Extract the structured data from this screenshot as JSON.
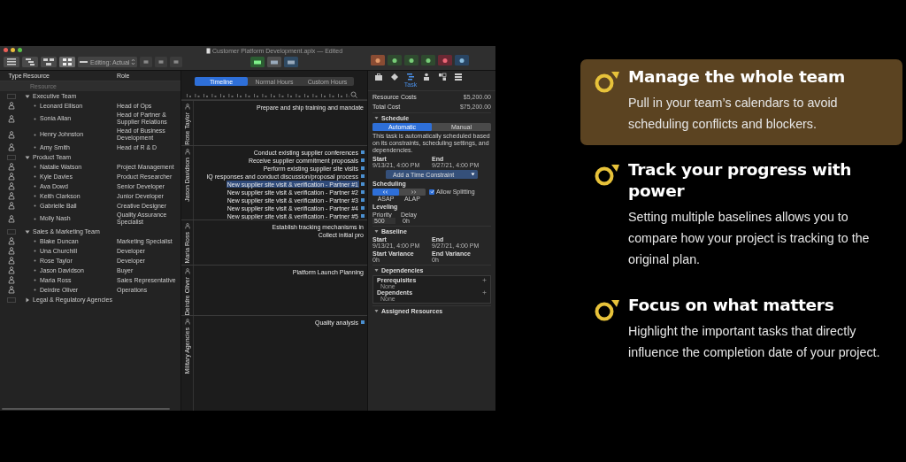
{
  "window": {
    "title": "Customer Platform Development.aplx — Edited",
    "mode_dropdown": "Editing: Actual"
  },
  "resource_table": {
    "columns": [
      "Type",
      "Resource",
      "Role"
    ],
    "placeholder": "Resource",
    "rows": [
      {
        "kind": "group",
        "name": "Executive Team",
        "expanded": true,
        "children": [
          {
            "kind": "person",
            "name": "Leonard Ellison",
            "role": "Head of Ops"
          },
          {
            "kind": "person",
            "name": "Sonia Allan",
            "role": "Head of Partner & Supplier Relations"
          },
          {
            "kind": "person",
            "name": "Henry Johnston",
            "role": "Head of Business Development"
          },
          {
            "kind": "person",
            "name": "Amy Smith",
            "role": "Head of R & D"
          }
        ]
      },
      {
        "kind": "group",
        "name": "Product Team",
        "expanded": true,
        "children": [
          {
            "kind": "person",
            "name": "Natalie Watson",
            "role": "Project Management"
          },
          {
            "kind": "person",
            "name": "Kyle Davies",
            "role": "Product Researcher"
          },
          {
            "kind": "person",
            "name": "Ava Dowd",
            "role": "Senior Developer"
          },
          {
            "kind": "person",
            "name": "Keith Clarkson",
            "role": "Junior Developer"
          },
          {
            "kind": "person",
            "name": "Gabrielle Ball",
            "role": "Creative Designer"
          },
          {
            "kind": "person",
            "name": "Molly Nash",
            "role": "Quality Assurance Specialist"
          }
        ]
      },
      {
        "kind": "group",
        "name": "Sales & Marketing Team",
        "expanded": true,
        "children": [
          {
            "kind": "person",
            "name": "Blake Duncan",
            "role": "Marketing Specialist"
          },
          {
            "kind": "person",
            "name": "Una Churchill",
            "role": "Developer"
          },
          {
            "kind": "person",
            "name": "Rose Taylor",
            "role": "Developer"
          },
          {
            "kind": "person",
            "name": "Jason Davidson",
            "role": "Buyer"
          },
          {
            "kind": "person",
            "name": "Maria Ross",
            "role": "Sales Representative"
          },
          {
            "kind": "person",
            "name": "Deirdre Oliver",
            "role": "Operations"
          }
        ]
      },
      {
        "kind": "group",
        "name": "Legal & Regulatory Agencies",
        "expanded": false,
        "children": []
      }
    ]
  },
  "timeline": {
    "tabs": [
      {
        "label": "Timeline",
        "selected": true
      },
      {
        "label": "Normal Hours",
        "selected": false
      },
      {
        "label": "Custom Hours",
        "selected": false
      }
    ],
    "lanes": [
      {
        "name": "Rose Taylor",
        "tasks": [
          {
            "label": "Prepare and ship training and mandate",
            "marker": false,
            "selected": false
          }
        ]
      },
      {
        "name": "Jason Davidson",
        "tasks": [
          {
            "label": "Conduct existing supplier conferences",
            "marker": true,
            "selected": false
          },
          {
            "label": "Receive supplier commitment proposals",
            "marker": true,
            "selected": false
          },
          {
            "label": "Perform existing supplier site visits",
            "marker": true,
            "selected": false
          },
          {
            "label": "IQ responses and conduct discussion/proposal process",
            "marker": true,
            "selected": false
          },
          {
            "label": "New supplier site visit & verification - Partner #1",
            "marker": true,
            "selected": true
          },
          {
            "label": "New supplier site visit & verification - Partner #2",
            "marker": true,
            "selected": false
          },
          {
            "label": "New supplier site visit & verification - Partner #3",
            "marker": true,
            "selected": false
          },
          {
            "label": "New supplier site visit & verification - Partner #4",
            "marker": true,
            "selected": false
          },
          {
            "label": "New supplier site visit & verification - Partner #5",
            "marker": true,
            "selected": false
          }
        ]
      },
      {
        "name": "Maria Ross",
        "tasks": [
          {
            "label": "Establish tracking mechanisms in",
            "marker": false,
            "selected": false
          },
          {
            "label": "Collect initial pro",
            "marker": false,
            "selected": false
          }
        ]
      },
      {
        "name": "Deirdre Oliver",
        "tasks": [
          {
            "label": "Platform Launch Planning",
            "marker": false,
            "selected": false
          }
        ]
      },
      {
        "name": "Military Agencies",
        "tasks": [
          {
            "label": "Quality analysis",
            "marker": true,
            "selected": false
          }
        ]
      }
    ]
  },
  "inspector": {
    "tabs": [
      {
        "selected": false
      },
      {
        "selected": false
      },
      {
        "label": "Task",
        "selected": true
      },
      {
        "selected": false
      },
      {
        "selected": false
      },
      {
        "selected": false
      }
    ],
    "costs": [
      {
        "label": "Resource Costs",
        "value": "$5,200.00"
      },
      {
        "label": "Total Cost",
        "value": "$75,200.00"
      }
    ],
    "schedule": {
      "title": "Schedule",
      "modes": [
        {
          "label": "Automatic",
          "selected": true
        },
        {
          "label": "Manual",
          "selected": false
        }
      ],
      "note": "This task is automatically scheduled based on its constraints, scheduling settings, and dependencies.",
      "fields": [
        {
          "label": "Start",
          "value": "9/13/21, 4:00 PM"
        },
        {
          "label": "End",
          "value": "9/27/21, 4:00 PM"
        }
      ],
      "constraint": "Add a Time Constraint",
      "scheduling_label": "Scheduling",
      "options": [
        {
          "label": "ASAP",
          "selected": true
        },
        {
          "label": "ALAP",
          "selected": false
        }
      ],
      "split": {
        "label": "Allow Splitting",
        "checked": true
      },
      "leveling_label": "Leveling",
      "leveling": [
        {
          "label": "Priority",
          "value": "500"
        },
        {
          "label": "Delay",
          "value": "0h"
        }
      ]
    },
    "baseline": {
      "title": "Baseline",
      "fields": [
        {
          "label": "Start",
          "value": "9/13/21, 4:00 PM"
        },
        {
          "label": "End",
          "value": "9/27/21, 4:00 PM"
        },
        {
          "label": "Start Variance",
          "value": "0h"
        },
        {
          "label": "End Variance",
          "value": "0h"
        }
      ]
    },
    "dependencies": {
      "title": "Dependencies",
      "groups": [
        {
          "label": "Prerequisites",
          "value": "None"
        },
        {
          "label": "Dependents",
          "value": "None"
        }
      ]
    },
    "assigned": {
      "title": "Assigned Resources"
    }
  },
  "features": [
    {
      "title": "Manage the whole team",
      "text": "Pull in your team’s calendars to avoid scheduling conflicts and blockers.",
      "selected": true
    },
    {
      "title": "Track your progress with power",
      "text": "Setting multiple baselines allows you to compare how your project is tracking to the original plan.",
      "selected": false
    },
    {
      "title": "Focus on what matters",
      "text": "Highlight the important tasks that directly influence the completion date of your project.",
      "selected": false
    }
  ]
}
